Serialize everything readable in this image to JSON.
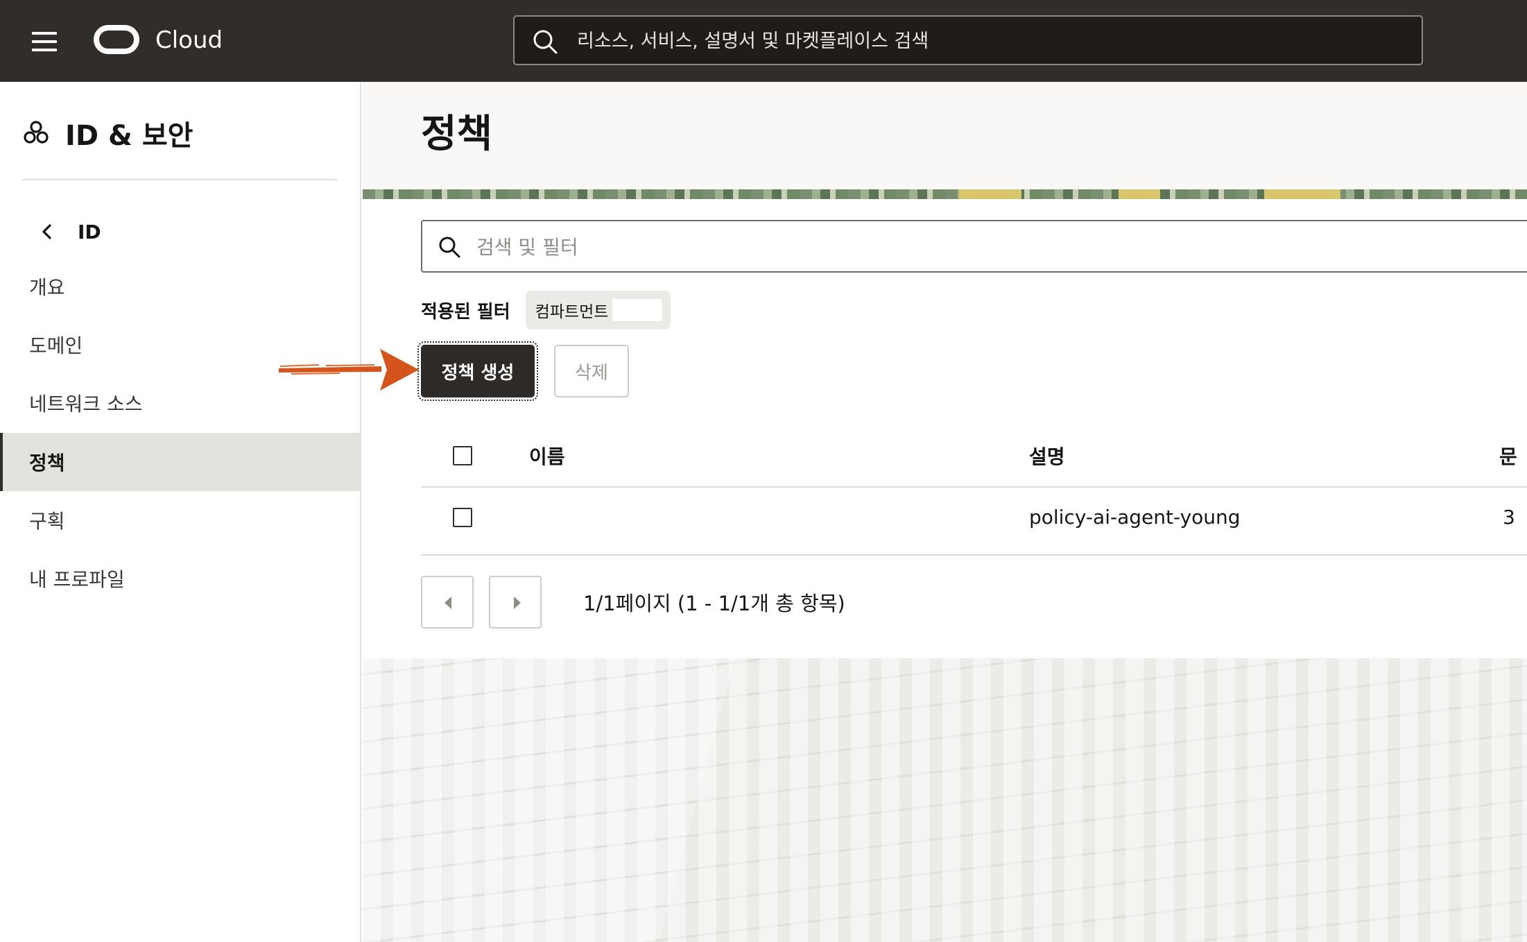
{
  "topbar": {
    "brand": "Cloud",
    "search_placeholder": "리소스, 서비스, 설명서 및 마켓플레이스 검색"
  },
  "sidebar": {
    "title": "ID & 보안",
    "back_label": "ID",
    "items": [
      {
        "label": "개요",
        "active": false
      },
      {
        "label": "도메인",
        "active": false
      },
      {
        "label": "네트워크 소스",
        "active": false
      },
      {
        "label": "정책",
        "active": true
      },
      {
        "label": "구획",
        "active": false
      },
      {
        "label": "내 프로파일",
        "active": false
      }
    ]
  },
  "main": {
    "title": "정책",
    "filter_placeholder": "검색 및 필터",
    "applied_filters_label": "적용된 필터",
    "filter_chip_label": "컴파트먼트",
    "create_button": "정책 생성",
    "delete_button": "삭제",
    "table": {
      "columns": [
        "이름",
        "설명",
        "문"
      ],
      "rows": [
        {
          "name": "",
          "description": "policy-ai-agent-young",
          "statements": "3"
        }
      ]
    },
    "pagination": "1/1페이지 (1 - 1/1개 총 항목)"
  },
  "colors": {
    "topbar_bg": "#312d2a",
    "primary_button": "#2d2a27",
    "active_nav_bg": "#e4e2df",
    "annotation_arrow": "#d4541c"
  }
}
